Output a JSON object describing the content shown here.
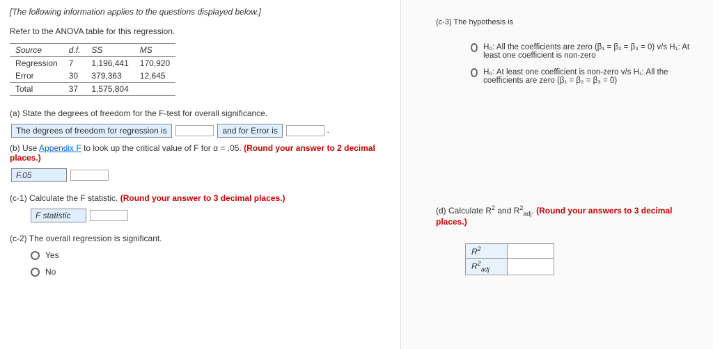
{
  "header": {
    "instruction": "[The following information applies to the questions displayed below.]",
    "lead": "Refer to the ANOVA table for this regression."
  },
  "anova": {
    "columns": [
      "Source",
      "d.f.",
      "SS",
      "MS"
    ],
    "rows": [
      {
        "source": "Regression",
        "df": "7",
        "ss": "1,196,441",
        "ms": "170,920"
      },
      {
        "source": "Error",
        "df": "30",
        "ss": "379,363",
        "ms": "12,645"
      },
      {
        "source": "Total",
        "df": "37",
        "ss": "1,575,804",
        "ms": ""
      }
    ]
  },
  "qa": {
    "a_prompt": "(a) State the degrees of freedom for the F-test for overall significance.",
    "a_label_reg": "The degrees of freedom for regression is",
    "a_label_err": "and for Error is",
    "b_prompt_pre": "(b) Use ",
    "b_link": "Appendix F",
    "b_prompt_post": " to look up the critical value of F for α = .05. ",
    "b_round": "(Round your answer to 2 decimal places.)",
    "b_box": "F.05",
    "c1_prompt": "(c-1) Calculate the F statistic. ",
    "c1_round": "(Round your answer to 3 decimal places.)",
    "c1_box": "F statistic",
    "c2_prompt": "(c-2)  The overall regression is significant.",
    "yes": "Yes",
    "no": "No"
  },
  "right": {
    "c3_prompt": "(c-3)  The hypothesis is",
    "c3_opt1": "H₀: All the coefficients are zero (β₁ = β₂ = β₃ = 0) v/s H₁: At least one coefficient is non-zero",
    "c3_opt2": "H₀: At least one coefficient is non-zero v/s H₁: All the coefficients are zero (β₁ = β₂ = β₃ = 0)",
    "d_prompt_pre": "(d) Calculate R",
    "d_prompt_mid": " and R",
    "d_prompt_post": ". ",
    "d_sup": "2",
    "d_adj": "adj",
    "d_round": "(Round your answers to 3 decimal places.)",
    "d_row1": "R²",
    "d_row2": "R²adj"
  }
}
